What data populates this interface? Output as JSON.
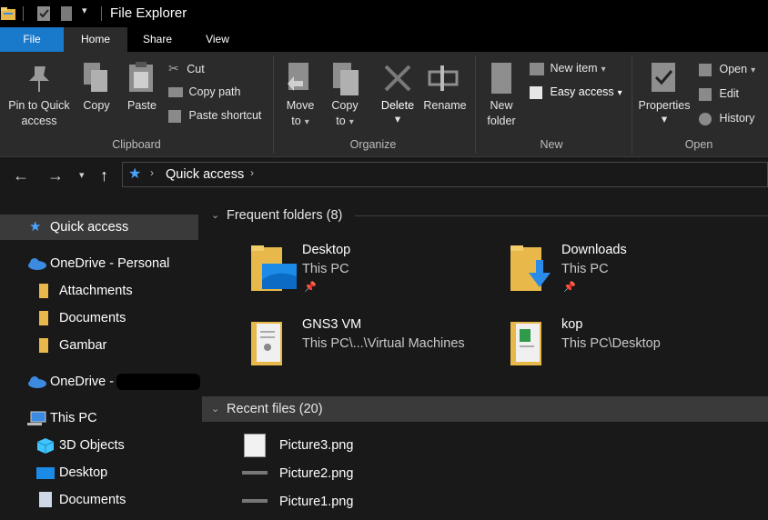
{
  "window": {
    "title": "File Explorer"
  },
  "tabs": [
    "File",
    "Home",
    "Share",
    "View"
  ],
  "ribbon": {
    "clipboard": {
      "pin_label": "Pin to Quick\naccess",
      "pin_l1": "Pin to Quick",
      "pin_l2": "access",
      "copy": "Copy",
      "paste": "Paste",
      "cut": "Cut",
      "copy_path": "Copy path",
      "paste_shortcut": "Paste shortcut",
      "group": "Clipboard"
    },
    "organize": {
      "move_l1": "Move",
      "move_l2": "to",
      "copy_l1": "Copy",
      "copy_l2": "to",
      "delete": "Delete",
      "rename": "Rename",
      "group": "Organize"
    },
    "new": {
      "folder_l1": "New",
      "folder_l2": "folder",
      "new_item": "New item",
      "easy_access": "Easy access",
      "group": "New"
    },
    "open": {
      "properties": "Properties",
      "open": "Open",
      "edit": "Edit",
      "history": "History",
      "group": "Open"
    }
  },
  "address": {
    "location": "Quick access"
  },
  "sidebar": {
    "items": [
      "Quick access",
      "OneDrive - Personal",
      "Attachments",
      "Documents",
      "Gambar",
      "OneDrive -",
      "This PC",
      "3D Objects",
      "Desktop",
      "Documents"
    ]
  },
  "main": {
    "frequent": {
      "header": "Frequent folders (8)",
      "folders": [
        {
          "name": "Desktop",
          "path": "This PC",
          "pinned": true
        },
        {
          "name": "Downloads",
          "path": "This PC",
          "pinned": true
        },
        {
          "name": "GNS3 VM",
          "path": "This PC\\...\\Virtual Machines",
          "pinned": false
        },
        {
          "name": "kop",
          "path": "This PC\\Desktop",
          "pinned": false
        }
      ]
    },
    "recent": {
      "header": "Recent files (20)",
      "files": [
        "Picture3.png",
        "Picture2.png",
        "Picture1.png"
      ]
    }
  },
  "colors": {
    "accent": "#1979ca",
    "folder": "#e8b94a",
    "onedrive": "#3c8be0",
    "quick_star": "#4aa3ff"
  }
}
